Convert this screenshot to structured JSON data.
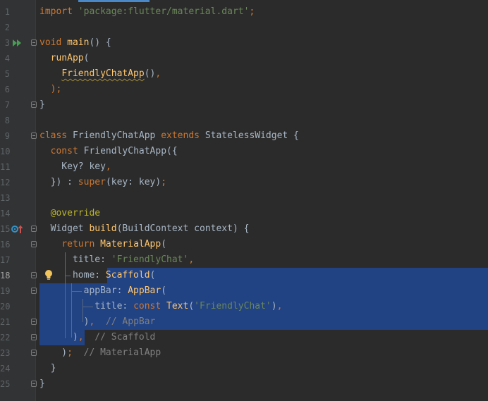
{
  "editor": {
    "language": "dart",
    "current_line": 18,
    "colors": {
      "background": "#2b2b2b",
      "gutter": "#313335",
      "selection": "#214283",
      "keyword": "#cc7832",
      "string": "#6a8759",
      "function": "#ffc66d",
      "comment": "#808080",
      "annotation": "#bbb529"
    },
    "gutter_icons": {
      "run": "run-gutter-icon",
      "override": "override-marker-icon",
      "intention": "lightbulb-icon"
    },
    "lines": [
      {
        "number": "1",
        "tokens": [
          {
            "t": "import ",
            "c": "kw"
          },
          {
            "t": "'package:flutter/material.dart'",
            "c": "str"
          },
          {
            "t": ";",
            "c": "kw"
          }
        ]
      },
      {
        "number": "2",
        "tokens": []
      },
      {
        "number": "3",
        "tokens": [
          {
            "t": "void ",
            "c": "kw"
          },
          {
            "t": "main",
            "c": "fn"
          },
          {
            "t": "() {",
            "c": "plain"
          }
        ]
      },
      {
        "number": "4",
        "tokens": [
          {
            "t": "  ",
            "c": "plain"
          },
          {
            "t": "runApp",
            "c": "fn"
          },
          {
            "t": "(",
            "c": "plain"
          }
        ]
      },
      {
        "number": "5",
        "tokens": [
          {
            "t": "    ",
            "c": "plain"
          },
          {
            "t": "FriendlyChatApp",
            "c": "fn squiggle"
          },
          {
            "t": "()",
            "c": "plain"
          },
          {
            "t": ",",
            "c": "kw"
          }
        ]
      },
      {
        "number": "6",
        "tokens": [
          {
            "t": "  );",
            "c": "kw"
          }
        ]
      },
      {
        "number": "7",
        "tokens": [
          {
            "t": "}",
            "c": "plain"
          }
        ]
      },
      {
        "number": "8",
        "tokens": []
      },
      {
        "number": "9",
        "tokens": [
          {
            "t": "class ",
            "c": "kw"
          },
          {
            "t": "FriendlyChatApp ",
            "c": "cls"
          },
          {
            "t": "extends ",
            "c": "kw"
          },
          {
            "t": "StatelessWidget {",
            "c": "cls"
          }
        ]
      },
      {
        "number": "10",
        "tokens": [
          {
            "t": "  ",
            "c": "plain"
          },
          {
            "t": "const ",
            "c": "kw"
          },
          {
            "t": "FriendlyChatApp({",
            "c": "plain"
          }
        ]
      },
      {
        "number": "11",
        "tokens": [
          {
            "t": "    Key? key",
            "c": "plain"
          },
          {
            "t": ",",
            "c": "kw"
          }
        ]
      },
      {
        "number": "12",
        "tokens": [
          {
            "t": "  }) : ",
            "c": "plain"
          },
          {
            "t": "super",
            "c": "kw"
          },
          {
            "t": "(key: key)",
            "c": "plain"
          },
          {
            "t": ";",
            "c": "kw"
          }
        ]
      },
      {
        "number": "13",
        "tokens": []
      },
      {
        "number": "14",
        "tokens": [
          {
            "t": "  ",
            "c": "plain"
          },
          {
            "t": "@override",
            "c": "ann"
          }
        ]
      },
      {
        "number": "15",
        "tokens": [
          {
            "t": "  Widget ",
            "c": "plain"
          },
          {
            "t": "build",
            "c": "fn"
          },
          {
            "t": "(BuildContext context) {",
            "c": "plain"
          }
        ]
      },
      {
        "number": "16",
        "tokens": [
          {
            "t": "    ",
            "c": "plain"
          },
          {
            "t": "return ",
            "c": "kw"
          },
          {
            "t": "MaterialApp",
            "c": "fn"
          },
          {
            "t": "(",
            "c": "plain"
          }
        ]
      },
      {
        "number": "17",
        "tokens": [
          {
            "t": "      title: ",
            "c": "plain"
          },
          {
            "t": "'FriendlyChat'",
            "c": "str"
          },
          {
            "t": ",",
            "c": "kw"
          }
        ]
      },
      {
        "number": "18",
        "tokens": [
          {
            "t": "      home: ",
            "c": "plain"
          },
          {
            "t": "Scaffold",
            "c": "fn"
          },
          {
            "t": "(",
            "c": "plain"
          }
        ]
      },
      {
        "number": "19",
        "tokens": [
          {
            "t": "        appBar: ",
            "c": "plain"
          },
          {
            "t": "AppBar",
            "c": "fn"
          },
          {
            "t": "(",
            "c": "plain"
          }
        ]
      },
      {
        "number": "20",
        "tokens": [
          {
            "t": "          title: ",
            "c": "plain"
          },
          {
            "t": "const ",
            "c": "kw"
          },
          {
            "t": "Text",
            "c": "fn"
          },
          {
            "t": "(",
            "c": "plain"
          },
          {
            "t": "'FriendlyChat'",
            "c": "str"
          },
          {
            "t": ")",
            "c": "plain"
          },
          {
            "t": ",",
            "c": "kw"
          }
        ]
      },
      {
        "number": "21",
        "tokens": [
          {
            "t": "        )",
            "c": "plain"
          },
          {
            "t": ",  ",
            "c": "kw"
          },
          {
            "t": "// AppBar",
            "c": "cmt"
          }
        ]
      },
      {
        "number": "22",
        "tokens": [
          {
            "t": "      )",
            "c": "plain"
          },
          {
            "t": ",  ",
            "c": "kw"
          },
          {
            "t": "// Scaffold",
            "c": "cmt"
          }
        ]
      },
      {
        "number": "23",
        "tokens": [
          {
            "t": "    )",
            "c": "plain"
          },
          {
            "t": ";  ",
            "c": "kw"
          },
          {
            "t": "// MaterialApp",
            "c": "cmt"
          }
        ]
      },
      {
        "number": "24",
        "tokens": [
          {
            "t": "  }",
            "c": "plain"
          }
        ]
      },
      {
        "number": "25",
        "tokens": [
          {
            "t": "}",
            "c": "plain"
          }
        ]
      }
    ]
  }
}
